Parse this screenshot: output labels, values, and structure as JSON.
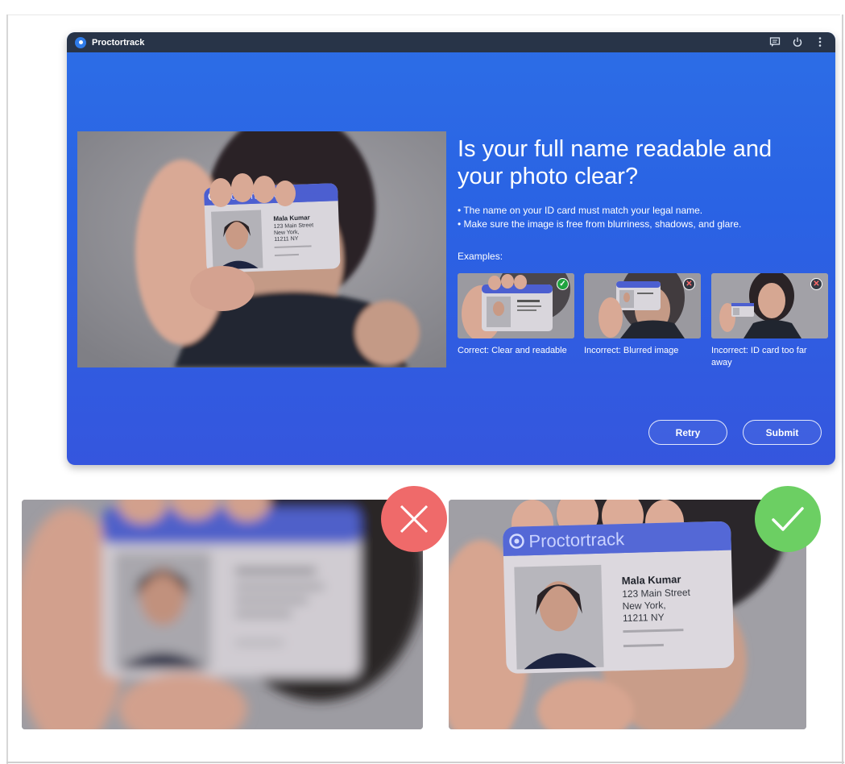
{
  "window": {
    "app_name": "Proctortrack",
    "icons": [
      "chat-icon",
      "power-icon",
      "more-vert-icon"
    ]
  },
  "question": {
    "headline": "Is your full name readable and your photo clear?",
    "bullets": [
      "• The name on your ID card must match your legal name.",
      "• Make sure the image is free from blurriness, shadows, and glare."
    ]
  },
  "examples": {
    "label": "Examples:",
    "items": [
      {
        "caption": "Correct: Clear and readable",
        "status": "correct"
      },
      {
        "caption": "Incorrect: Blurred image",
        "status": "incorrect"
      },
      {
        "caption": "Incorrect: ID card too far away",
        "status": "incorrect"
      }
    ]
  },
  "buttons": {
    "retry": "Retry",
    "submit": "Submit"
  },
  "id_card": {
    "brand": "Proctortrack",
    "name": "Mala Kumar",
    "address_line1": "123 Main Street",
    "address_line2": "New York,",
    "address_line3": "11211 NY"
  },
  "colors": {
    "accent_blue": "#2d6ee6",
    "titlebar": "#283448",
    "correct_green": "#6ccf63",
    "incorrect_red": "#ef6a6a"
  }
}
